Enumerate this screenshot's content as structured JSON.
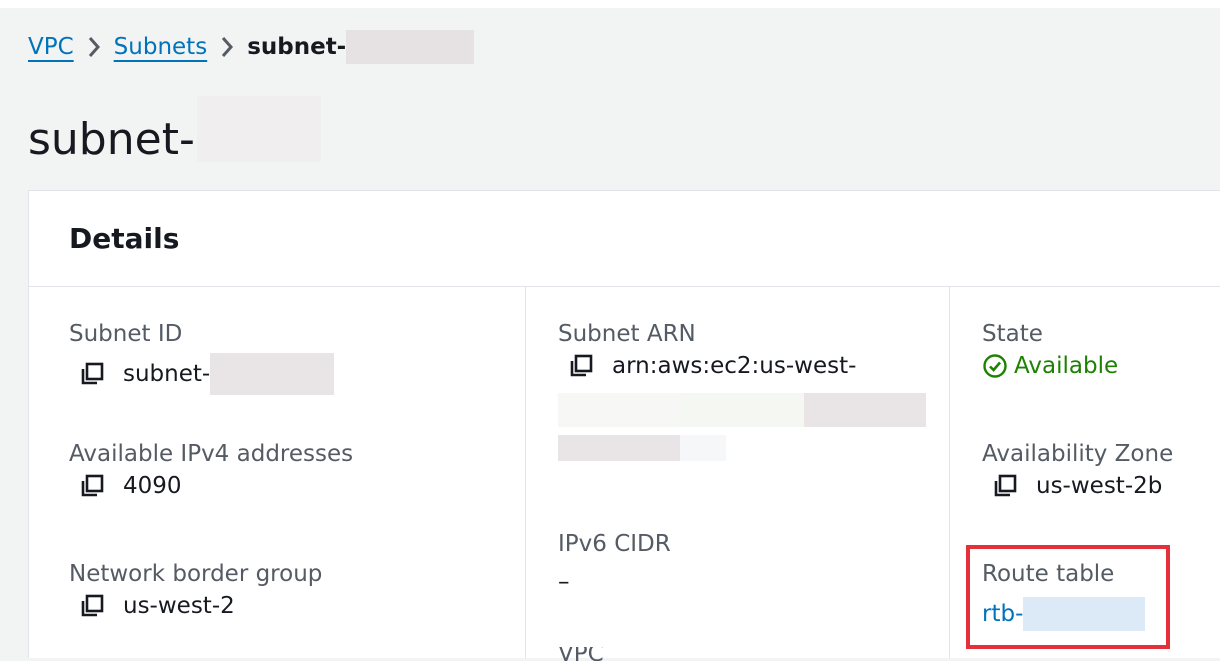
{
  "breadcrumb": {
    "items": [
      "VPC",
      "Subnets"
    ],
    "current": "subnet-"
  },
  "page": {
    "title": "subnet-"
  },
  "details": {
    "heading": "Details",
    "subnet_id": {
      "label": "Subnet ID",
      "value": "subnet-"
    },
    "available_ipv4": {
      "label": "Available IPv4 addresses",
      "value": "4090"
    },
    "network_border_group": {
      "label": "Network border group",
      "value": "us-west-2"
    },
    "subnet_arn": {
      "label": "Subnet ARN",
      "value": "arn:aws:ec2:us-west-"
    },
    "ipv6_cidr": {
      "label": "IPv6 CIDR",
      "value": "–"
    },
    "vpc": {
      "label": "VPC"
    },
    "state": {
      "label": "State",
      "value": "Available",
      "color": "#1d8102"
    },
    "availability_zone": {
      "label": "Availability Zone",
      "value": "us-west-2b"
    },
    "route_table": {
      "label": "Route table",
      "value": "rtb-"
    }
  },
  "colors": {
    "link": "#0073bb",
    "highlight_border": "#e3303b"
  },
  "icons": {
    "copy": "copy-icon",
    "separator": "chevron-right-icon",
    "status": "check-circle-icon"
  }
}
